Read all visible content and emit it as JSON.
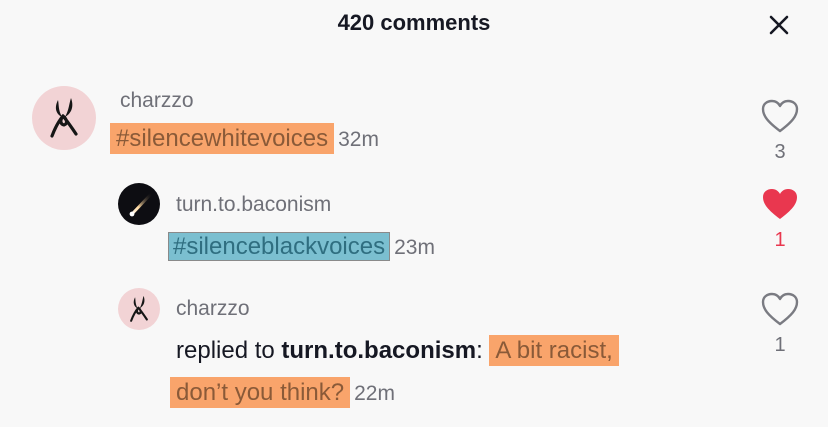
{
  "header": {
    "title": "420 comments"
  },
  "icons": {
    "close": "close-icon",
    "heart": "heart-icon"
  },
  "colors": {
    "liked": "#e9374f",
    "highlight_orange": "#f9a46b",
    "highlight_blue": "#7bbfd0"
  },
  "comments": [
    {
      "username": "charzzo",
      "text": "#silencewhitevoices",
      "time": "32m",
      "likes": "3",
      "liked": false
    },
    {
      "username": "turn.to.baconism",
      "text": "#silenceblackvoices",
      "time": "23m",
      "likes": "1",
      "liked": true
    },
    {
      "username": "charzzo",
      "reply_prefix": "replied to",
      "reply_to": "turn.to.baconism",
      "reply_sep": ":",
      "text_line1": "A bit racist,",
      "text_line2": "don’t you think?",
      "time": "22m",
      "likes": "1",
      "liked": false
    }
  ]
}
